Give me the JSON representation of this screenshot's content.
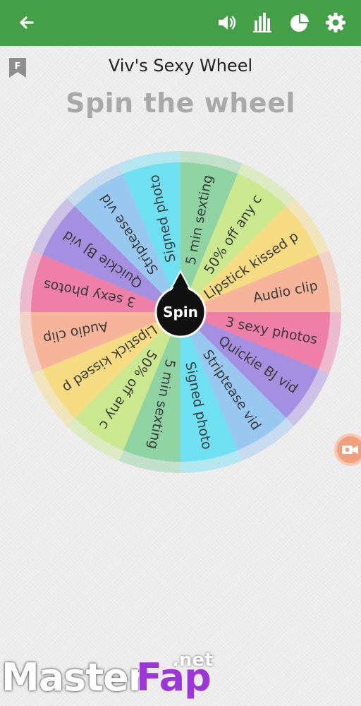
{
  "appbar": {
    "color": "#44a047",
    "icons": [
      "back-arrow-icon",
      "volume-icon",
      "bar-chart-icon",
      "pie-chart-icon",
      "gear-icon"
    ]
  },
  "wheel_name": "Viv's Sexy Wheel",
  "bookmark_letter": "F",
  "heading": "Spin the wheel",
  "spin_button": "Spin",
  "segments": [
    {
      "label": "5 min sexting",
      "color": "#8fd3a2"
    },
    {
      "label": "50% off any c",
      "color": "#cbe88f"
    },
    {
      "label": "Lipstick kissed p",
      "color": "#f5dc82"
    },
    {
      "label": "Audio clip",
      "color": "#f6b49a"
    },
    {
      "label": "3 sexy photos",
      "color": "#ee7fa6"
    },
    {
      "label": "Quickie BJ vid",
      "color": "#a58fe0"
    },
    {
      "label": "Striptease vid",
      "color": "#98c8ef"
    },
    {
      "label": "Signed photo",
      "color": "#6fe0f2"
    },
    {
      "label": "5 min sexting",
      "color": "#8fd3a2"
    },
    {
      "label": "50% off any c",
      "color": "#cbe88f"
    },
    {
      "label": "Lipstick kissed p",
      "color": "#f5dc82"
    },
    {
      "label": "Audio clip",
      "color": "#f6b49a"
    },
    {
      "label": "3 sexy photos",
      "color": "#ee7fa6"
    },
    {
      "label": "Quickie BJ vid",
      "color": "#a58fe0"
    },
    {
      "label": "Striptease vid",
      "color": "#98c8ef"
    },
    {
      "label": "Signed photo",
      "color": "#6fe0f2"
    }
  ],
  "watermark": {
    "part1": "Master",
    "part2": "Fap",
    "part3": ".net"
  }
}
